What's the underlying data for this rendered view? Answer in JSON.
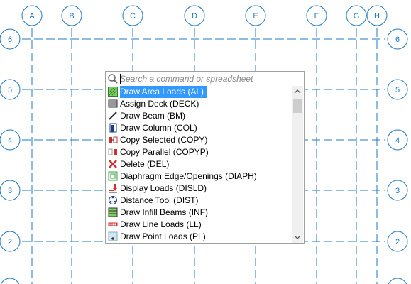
{
  "grid": {
    "column_labels": [
      "A",
      "B",
      "C",
      "D",
      "E",
      "F",
      "G",
      "H"
    ],
    "row_labels": [
      "6",
      "5",
      "4",
      "3",
      "2"
    ],
    "line_color": "#1f78c1"
  },
  "search": {
    "placeholder": "Search a command or spreadsheet"
  },
  "commands": [
    {
      "label": "Draw Area Loads (AL)",
      "icon": "area-load-icon",
      "selected": true
    },
    {
      "label": "Assign Deck (DECK)",
      "icon": "deck-icon"
    },
    {
      "label": "Draw Beam (BM)",
      "icon": "beam-icon"
    },
    {
      "label": "Draw Column (COL)",
      "icon": "column-icon"
    },
    {
      "label": "Copy Selected (COPY)",
      "icon": "copy-icon"
    },
    {
      "label": "Copy Parallel (COPYP)",
      "icon": "copy-parallel-icon"
    },
    {
      "label": "Delete (DEL)",
      "icon": "delete-icon"
    },
    {
      "label": "Diaphragm Edge/Openings (DIAPH)",
      "icon": "diaphragm-icon"
    },
    {
      "label": "Display Loads (DISLD)",
      "icon": "display-loads-icon"
    },
    {
      "label": "Distance Tool (DIST)",
      "icon": "distance-icon"
    },
    {
      "label": "Draw Infill Beams (INF)",
      "icon": "infill-beams-icon"
    },
    {
      "label": "Draw Line Loads (LL)",
      "icon": "line-load-icon"
    },
    {
      "label": "Draw Point Loads (PL)",
      "icon": "point-load-icon"
    }
  ],
  "colors": {
    "selection": "#3399ff",
    "grid": "#1f78c1"
  }
}
